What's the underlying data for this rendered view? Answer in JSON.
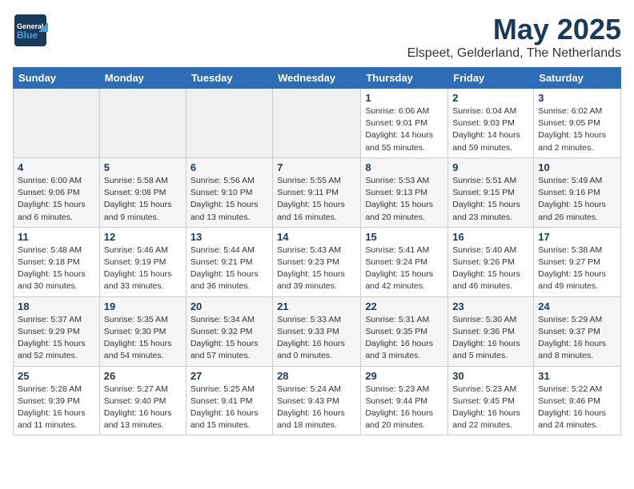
{
  "header": {
    "logo_general": "General",
    "logo_blue": "Blue",
    "month": "May 2025",
    "location": "Elspeet, Gelderland, The Netherlands"
  },
  "weekdays": [
    "Sunday",
    "Monday",
    "Tuesday",
    "Wednesday",
    "Thursday",
    "Friday",
    "Saturday"
  ],
  "weeks": [
    [
      {
        "day": "",
        "empty": true
      },
      {
        "day": "",
        "empty": true
      },
      {
        "day": "",
        "empty": true
      },
      {
        "day": "",
        "empty": true
      },
      {
        "day": "1",
        "sunrise": "Sunrise: 6:06 AM",
        "sunset": "Sunset: 9:01 PM",
        "daylight": "Daylight: 14 hours and 55 minutes."
      },
      {
        "day": "2",
        "sunrise": "Sunrise: 6:04 AM",
        "sunset": "Sunset: 9:03 PM",
        "daylight": "Daylight: 14 hours and 59 minutes."
      },
      {
        "day": "3",
        "sunrise": "Sunrise: 6:02 AM",
        "sunset": "Sunset: 9:05 PM",
        "daylight": "Daylight: 15 hours and 2 minutes."
      }
    ],
    [
      {
        "day": "4",
        "sunrise": "Sunrise: 6:00 AM",
        "sunset": "Sunset: 9:06 PM",
        "daylight": "Daylight: 15 hours and 6 minutes."
      },
      {
        "day": "5",
        "sunrise": "Sunrise: 5:58 AM",
        "sunset": "Sunset: 9:08 PM",
        "daylight": "Daylight: 15 hours and 9 minutes."
      },
      {
        "day": "6",
        "sunrise": "Sunrise: 5:56 AM",
        "sunset": "Sunset: 9:10 PM",
        "daylight": "Daylight: 15 hours and 13 minutes."
      },
      {
        "day": "7",
        "sunrise": "Sunrise: 5:55 AM",
        "sunset": "Sunset: 9:11 PM",
        "daylight": "Daylight: 15 hours and 16 minutes."
      },
      {
        "day": "8",
        "sunrise": "Sunrise: 5:53 AM",
        "sunset": "Sunset: 9:13 PM",
        "daylight": "Daylight: 15 hours and 20 minutes."
      },
      {
        "day": "9",
        "sunrise": "Sunrise: 5:51 AM",
        "sunset": "Sunset: 9:15 PM",
        "daylight": "Daylight: 15 hours and 23 minutes."
      },
      {
        "day": "10",
        "sunrise": "Sunrise: 5:49 AM",
        "sunset": "Sunset: 9:16 PM",
        "daylight": "Daylight: 15 hours and 26 minutes."
      }
    ],
    [
      {
        "day": "11",
        "sunrise": "Sunrise: 5:48 AM",
        "sunset": "Sunset: 9:18 PM",
        "daylight": "Daylight: 15 hours and 30 minutes."
      },
      {
        "day": "12",
        "sunrise": "Sunrise: 5:46 AM",
        "sunset": "Sunset: 9:19 PM",
        "daylight": "Daylight: 15 hours and 33 minutes."
      },
      {
        "day": "13",
        "sunrise": "Sunrise: 5:44 AM",
        "sunset": "Sunset: 9:21 PM",
        "daylight": "Daylight: 15 hours and 36 minutes."
      },
      {
        "day": "14",
        "sunrise": "Sunrise: 5:43 AM",
        "sunset": "Sunset: 9:23 PM",
        "daylight": "Daylight: 15 hours and 39 minutes."
      },
      {
        "day": "15",
        "sunrise": "Sunrise: 5:41 AM",
        "sunset": "Sunset: 9:24 PM",
        "daylight": "Daylight: 15 hours and 42 minutes."
      },
      {
        "day": "16",
        "sunrise": "Sunrise: 5:40 AM",
        "sunset": "Sunset: 9:26 PM",
        "daylight": "Daylight: 15 hours and 46 minutes."
      },
      {
        "day": "17",
        "sunrise": "Sunrise: 5:38 AM",
        "sunset": "Sunset: 9:27 PM",
        "daylight": "Daylight: 15 hours and 49 minutes."
      }
    ],
    [
      {
        "day": "18",
        "sunrise": "Sunrise: 5:37 AM",
        "sunset": "Sunset: 9:29 PM",
        "daylight": "Daylight: 15 hours and 52 minutes."
      },
      {
        "day": "19",
        "sunrise": "Sunrise: 5:35 AM",
        "sunset": "Sunset: 9:30 PM",
        "daylight": "Daylight: 15 hours and 54 minutes."
      },
      {
        "day": "20",
        "sunrise": "Sunrise: 5:34 AM",
        "sunset": "Sunset: 9:32 PM",
        "daylight": "Daylight: 15 hours and 57 minutes."
      },
      {
        "day": "21",
        "sunrise": "Sunrise: 5:33 AM",
        "sunset": "Sunset: 9:33 PM",
        "daylight": "Daylight: 16 hours and 0 minutes."
      },
      {
        "day": "22",
        "sunrise": "Sunrise: 5:31 AM",
        "sunset": "Sunset: 9:35 PM",
        "daylight": "Daylight: 16 hours and 3 minutes."
      },
      {
        "day": "23",
        "sunrise": "Sunrise: 5:30 AM",
        "sunset": "Sunset: 9:36 PM",
        "daylight": "Daylight: 16 hours and 5 minutes."
      },
      {
        "day": "24",
        "sunrise": "Sunrise: 5:29 AM",
        "sunset": "Sunset: 9:37 PM",
        "daylight": "Daylight: 16 hours and 8 minutes."
      }
    ],
    [
      {
        "day": "25",
        "sunrise": "Sunrise: 5:28 AM",
        "sunset": "Sunset: 9:39 PM",
        "daylight": "Daylight: 16 hours and 11 minutes."
      },
      {
        "day": "26",
        "sunrise": "Sunrise: 5:27 AM",
        "sunset": "Sunset: 9:40 PM",
        "daylight": "Daylight: 16 hours and 13 minutes."
      },
      {
        "day": "27",
        "sunrise": "Sunrise: 5:25 AM",
        "sunset": "Sunset: 9:41 PM",
        "daylight": "Daylight: 16 hours and 15 minutes."
      },
      {
        "day": "28",
        "sunrise": "Sunrise: 5:24 AM",
        "sunset": "Sunset: 9:43 PM",
        "daylight": "Daylight: 16 hours and 18 minutes."
      },
      {
        "day": "29",
        "sunrise": "Sunrise: 5:23 AM",
        "sunset": "Sunset: 9:44 PM",
        "daylight": "Daylight: 16 hours and 20 minutes."
      },
      {
        "day": "30",
        "sunrise": "Sunrise: 5:23 AM",
        "sunset": "Sunset: 9:45 PM",
        "daylight": "Daylight: 16 hours and 22 minutes."
      },
      {
        "day": "31",
        "sunrise": "Sunrise: 5:22 AM",
        "sunset": "Sunset: 9:46 PM",
        "daylight": "Daylight: 16 hours and 24 minutes."
      }
    ]
  ]
}
